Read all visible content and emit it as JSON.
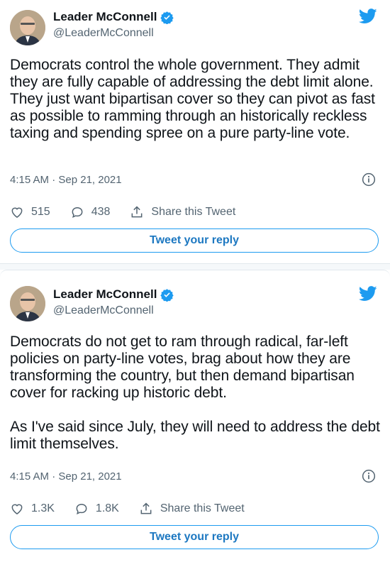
{
  "tweets": [
    {
      "author": {
        "name": "Leader McConnell",
        "handle": "@LeaderMcConnell"
      },
      "text": "Democrats control the whole government. They admit they are fully capable of addressing the debt limit alone. They just want bipartisan cover so they can pivot as fast as possible to ramming through an historically reckless taxing and spending spree on a pure party-line vote.",
      "timestamp": "4:15 AM · Sep 21, 2021",
      "likes": "515",
      "replies": "438",
      "share_label": "Share this Tweet",
      "reply_button": "Tweet your reply"
    },
    {
      "author": {
        "name": "Leader McConnell",
        "handle": "@LeaderMcConnell"
      },
      "text": "Democrats do not get to ram through radical, far-left policies on party-line votes, brag about how they are transforming the country, but then demand bipartisan cover for racking up historic debt.\n\nAs I've said since July, they will need to address the debt limit themselves.",
      "timestamp": "4:15 AM · Sep 21, 2021",
      "likes": "1.3K",
      "replies": "1.8K",
      "share_label": "Share this Tweet",
      "reply_button": "Tweet your reply"
    }
  ],
  "colors": {
    "accent": "#1d9bf0",
    "verified": "#1d9bf0",
    "muted": "#536471"
  },
  "icons": [
    "verified-badge-icon",
    "twitter-bird-icon",
    "info-icon",
    "heart-icon",
    "reply-icon",
    "share-icon"
  ]
}
